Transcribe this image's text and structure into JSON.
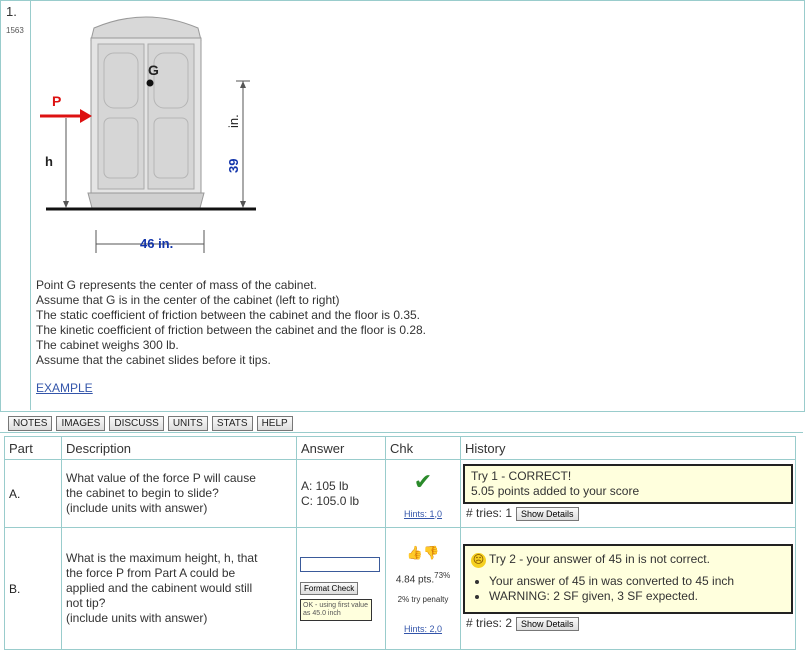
{
  "question": {
    "number": "1.",
    "id": "1563",
    "figure": {
      "force_label": "P",
      "cg_label": "G",
      "height_label": "h",
      "width_dim": "46 in.",
      "height_dim_value": "39",
      "height_dim_unit": "in."
    },
    "lines": [
      "Point G represents the center of mass of the cabinet.",
      "Assume that G is in the center of the cabinet (left to right)",
      "The static coefficient of friction between the cabinet and the floor is 0.35.",
      "The kinetic coefficient of friction between the cabinet and the floor is 0.28.",
      "The cabinet weighs 300 lb.",
      "Assume that the cabinet slides before it tips."
    ],
    "example_link": "EXAMPLE"
  },
  "toolbar": {
    "notes": "NOTES",
    "images": "IMAGES",
    "discuss": "DISCUSS",
    "units": "UNITS",
    "stats": "STATS",
    "help": "HELP"
  },
  "table": {
    "headers": {
      "part": "Part",
      "description": "Description",
      "answer": "Answer",
      "chk": "Chk",
      "history": "History"
    },
    "rows": [
      {
        "part": "A.",
        "desc": [
          "What value of the force P will cause",
          "the cabinet to begin to slide?",
          "(include units with answer)"
        ],
        "answer_a": "A: 105 lb",
        "answer_c": "C: 105.0 lb",
        "hints": "Hints: 1,0",
        "history_line1": "Try 1 - CORRECT!",
        "history_line2": "5.05 points added to your score",
        "tries": "# tries: 1",
        "details_button": "Show Details"
      },
      {
        "part": "B.",
        "desc": [
          "What is the maximum height, h, that",
          "the force P from Part A could be",
          "applied and the cabinent would still",
          "not tip?",
          "(include units with answer)"
        ],
        "answer_value": "",
        "format_button": "Format Check",
        "ok_text": "OK - using first value as 45.0 inch",
        "points": "4.84 pts.",
        "points_pct": "73%",
        "penalty": "2% try penalty",
        "hints": "Hints: 2,0",
        "history_title": "Try 2 - your answer of 45 in is not correct.",
        "bullets": [
          "Your answer of 45 in was converted to 45 inch",
          "WARNING: 2 SF given, 3 SF expected."
        ],
        "tries": "# tries: 2",
        "details_button": "Show Details"
      }
    ]
  },
  "colors": {
    "border": "#99cccc",
    "history_bg": "#ffffdd",
    "link": "#3355aa",
    "check_green": "#2a8a2a",
    "arrow_red": "#dd1111",
    "dim_blue": "#1133aa"
  }
}
